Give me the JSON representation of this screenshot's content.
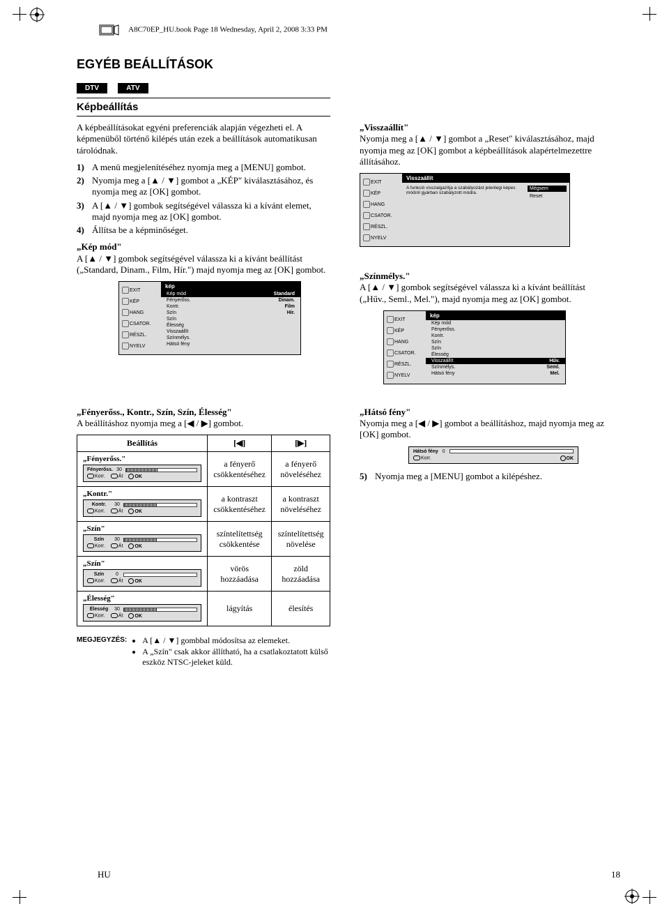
{
  "header_line": "A8C70EP_HU.book  Page 18  Wednesday, April 2, 2008  3:33 PM",
  "h1": "EGYÉB BEÁLLÍTÁSOK",
  "badges": [
    "DTV",
    "ATV"
  ],
  "h2": "Képbeállítás",
  "intro": "A képbeállításokat egyéni preferenciák alapján végezheti el. A képmenüből történő kilépés után ezek a beállítások automatikusan tárolódnak.",
  "steps_left": [
    "A menü megjelenítéséhez nyomja meg a [MENU] gombot.",
    "Nyomja meg a [▲ / ▼] gombot a „KÉP\" kiválasztásához, és nyomja meg az [OK] gombot.",
    "A [▲ / ▼] gombok segítségével válassza ki a kívánt elemet, majd nyomja meg az [OK] gombot.",
    "Állítsa be a képminőséget."
  ],
  "kepmod_title": "„Kép mód\"",
  "kepmod_text": "A [▲ / ▼] gombok segítségével válassza ki a kívánt beállítást („Standard, Dinam., Film, Hír.\") majd nyomja meg az [OK] gombot.",
  "reset_title": "„Visszaállít\"",
  "reset_text": "Nyomja meg a [▲ / ▼] gombot a „Reset\" kiválasztásához, majd nyomja meg az [OK] gombot a képbeállítások alapértelmezettre állításához.",
  "szinmely_title": "„Színmélys.\"",
  "szinmely_text": "A [▲ / ▼] gombok segítségével válassza ki a kívánt beállítást („Hűv., Seml., Mel.\"), majd nyomja meg az [OK] gombot.",
  "osd_side": [
    "EXIT",
    "KÉP",
    "HANG",
    "CSATOR.",
    "RÉSZL.",
    "NYELV"
  ],
  "osd1": {
    "title": "kép",
    "rows": [
      {
        "l": "Kép mód",
        "v": "Standard",
        "hi": true
      },
      {
        "l": "Fényerőss.",
        "v": "Dinam."
      },
      {
        "l": "Kontr.",
        "v": "Film"
      },
      {
        "l": "Szín",
        "v": "Hír."
      },
      {
        "l": "Szín",
        "v": ""
      },
      {
        "l": "Élesség",
        "v": ""
      },
      {
        "l": "Visszaállít",
        "v": ""
      },
      {
        "l": "Színmélys.",
        "v": ""
      },
      {
        "l": "Hátsó fény",
        "v": ""
      }
    ]
  },
  "osd_reset": {
    "title": "Visszaállít",
    "msg": "A funkció visszaigazítja a szabályozást jelenlegi képes módról gyárban szabályzott módra.",
    "btn1": "Mégsem",
    "btn2": "Reset"
  },
  "osd2": {
    "title": "kép",
    "rows": [
      {
        "l": "Kép mód",
        "v": ""
      },
      {
        "l": "Fényerőss.",
        "v": ""
      },
      {
        "l": "Kontr.",
        "v": ""
      },
      {
        "l": "Szín",
        "v": ""
      },
      {
        "l": "Szín",
        "v": ""
      },
      {
        "l": "Élesség",
        "v": ""
      },
      {
        "l": "Visszaállít",
        "v": "Hűv.",
        "hi": true
      },
      {
        "l": "Színmélys.",
        "v": "Seml."
      },
      {
        "l": "Hátsó fény",
        "v": "Mel."
      }
    ]
  },
  "adj_title": "„Fényerőss., Kontr., Szín, Szín, Élesség\"",
  "adj_text": "A beállításhoz nyomja meg a [◀ / ▶] gombot.",
  "adj_head": [
    "Beállítás",
    "[◀]",
    "[▶]"
  ],
  "adj_rows": [
    {
      "q": "„Fényerőss.\"",
      "name": "Fényerőss.",
      "val": "30",
      "l": "a fényerő csökkentéséhez",
      "r": "a fényerő növeléséhez",
      "fill": 45
    },
    {
      "q": "„Kontr.\"",
      "name": "Kontr.",
      "val": "30",
      "l": "a kontraszt csökkentéséhez",
      "r": "a kontraszt növeléséhez",
      "fill": 45
    },
    {
      "q": "„Szín\"",
      "name": "Szín",
      "val": "30",
      "l": "színtelítettség csökkentése",
      "r": "színtelítettség növelése",
      "fill": 45
    },
    {
      "q": "„Szín\"",
      "name": "Szín",
      "val": "0",
      "l": "vörös hozzáadása",
      "r": "zöld hozzáadása",
      "fill": 0
    },
    {
      "q": "„Élesség\"",
      "name": "Élesség",
      "val": "30",
      "l": "lágyítás",
      "r": "élesítés",
      "fill": 45
    }
  ],
  "slider_ctrls": {
    "korr": "Korr.",
    "at": "Át",
    "ok": "OK"
  },
  "hatso_title": "„Hátsó fény\"",
  "hatso_text": "Nyomja meg a [◀ / ▶] gombot a beállításhoz, majd nyomja meg az [OK] gombot.",
  "hatso_box": {
    "name": "Hátsó fény",
    "val": "0",
    "korr": "Korr.",
    "ok": "OK"
  },
  "step5": "Nyomja meg a [MENU] gombot a kilépéshez.",
  "note_label": "MEGJEGYZÉS:",
  "notes": [
    "A [▲ / ▼] gombbal módosítsa az elemeket.",
    "A „Szín\" csak akkor állítható, ha a csatlakoztatott külső eszköz NTSC-jeleket küld."
  ],
  "footer": {
    "l": "HU",
    "r": "18"
  }
}
